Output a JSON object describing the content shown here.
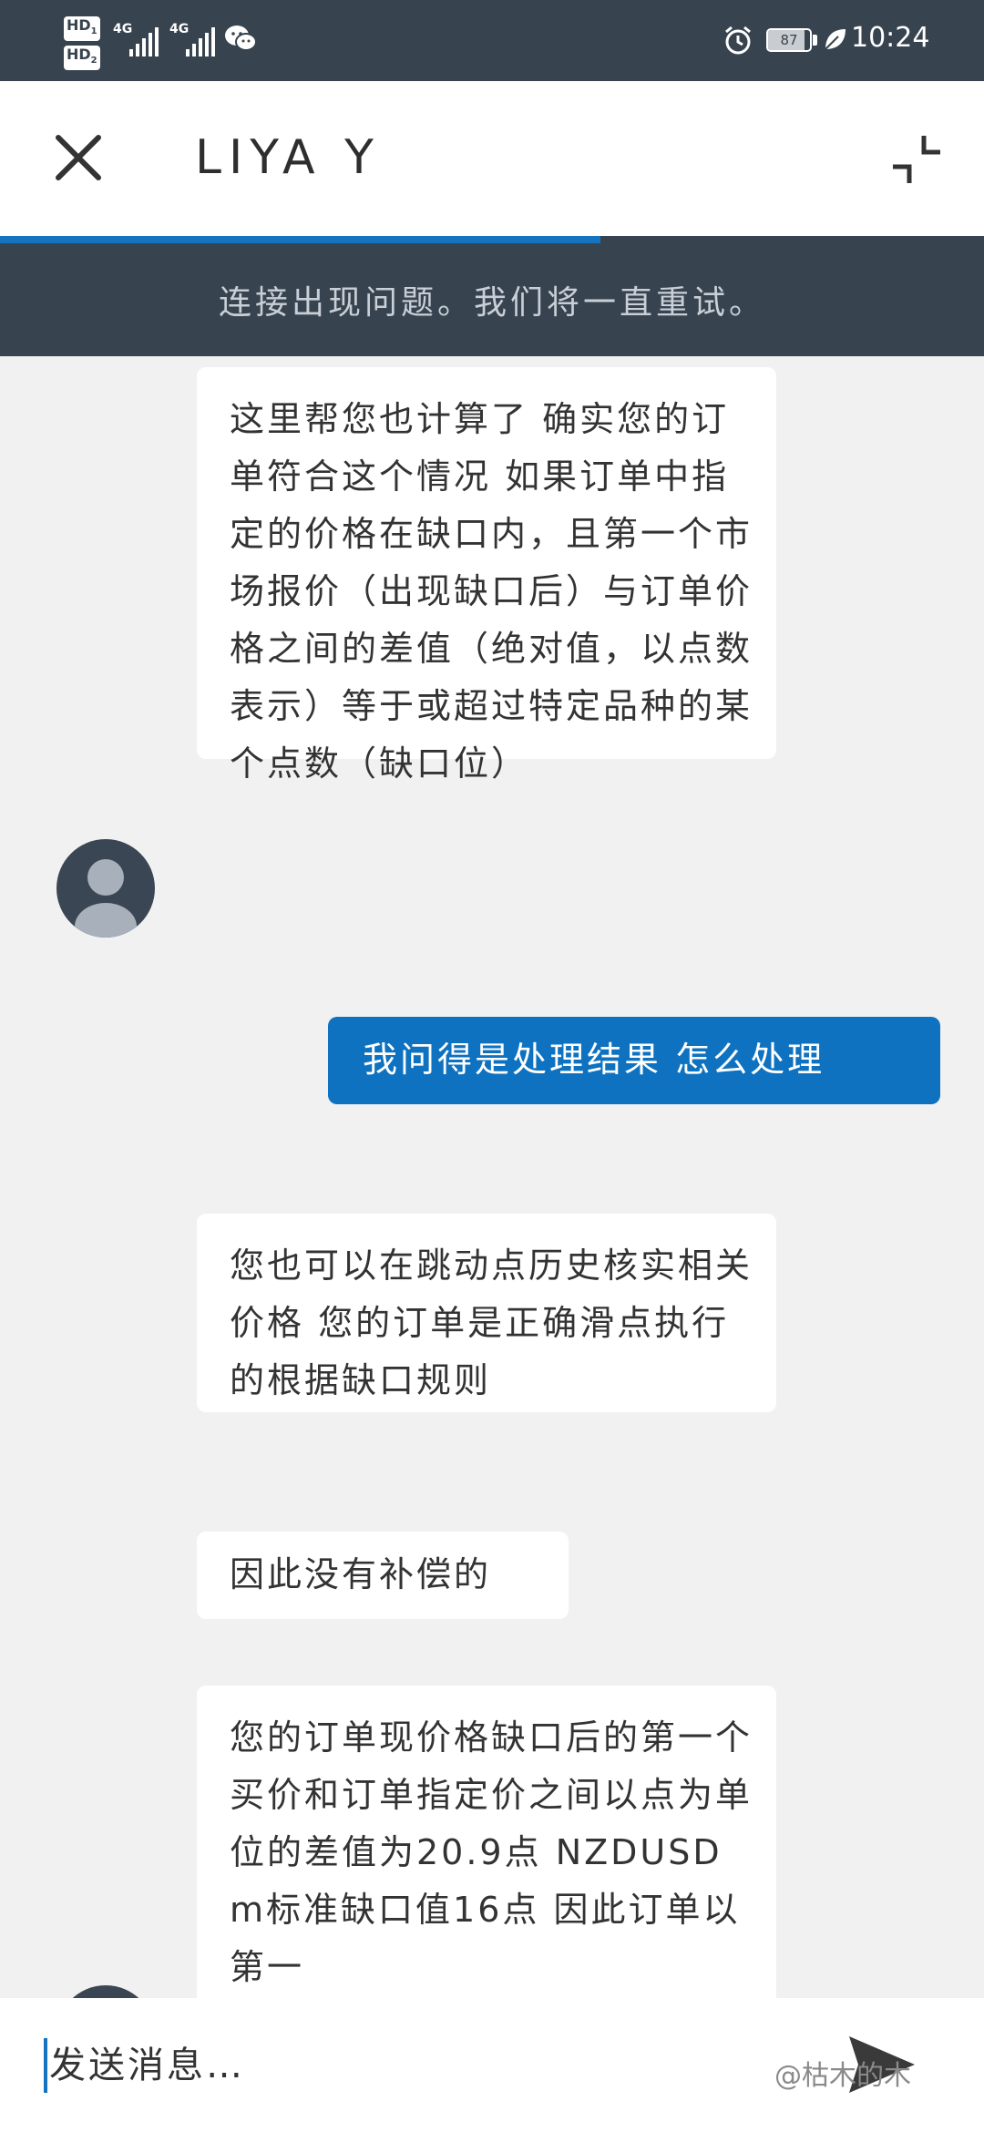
{
  "status_bar": {
    "hd1": "HD",
    "hd1_sub": "1",
    "hd2": "HD",
    "hd2_sub": "2",
    "sim1_network": "4G",
    "sim2_network": "4G",
    "battery": "87",
    "time": "10:24",
    "icons": [
      "wechat-icon",
      "alarm-icon",
      "battery-icon",
      "leaf-icon"
    ]
  },
  "header": {
    "title": "LIYA Y",
    "close_icon": "close-icon",
    "minimize_icon": "minimize-icon"
  },
  "connection": {
    "progress": 0.61,
    "accent": "#1573c0",
    "banner_text": "连接出现问题。我们将一直重试。"
  },
  "messages": [
    {
      "from": "agent",
      "text": "这里帮您也计算了 确实您的订单符合这个情况 如果订单中指定的价格在缺口内，且第一个市场报价（出现缺口后）与订单价格之间的差值（绝对值，以点数表示）等于或超过特定品种的某个点数（缺口位）"
    },
    {
      "from": "user",
      "text": "我问得是处理结果 怎么处理"
    },
    {
      "from": "agent",
      "text": "您也可以在跳动点历史核实相关价格 您的订单是正确滑点执行的根据缺口规则"
    },
    {
      "from": "agent",
      "text": "因此没有补偿的"
    },
    {
      "from": "agent",
      "text": "您的订单现价格缺口后的第一个买价和订单指定价之间以点为单位的差值为20.9点 NZDUSDm标准缺口值16点 因此订单以第一"
    }
  ],
  "composer": {
    "placeholder": "发送消息…",
    "send_icon": "send-icon",
    "watermark": "@枯木的木"
  },
  "colors": {
    "status_bar": "#37434f",
    "user_bubble": "#0e72c0",
    "agent_bubble": "#ffffff",
    "chat_background": "#f1f1f2"
  }
}
